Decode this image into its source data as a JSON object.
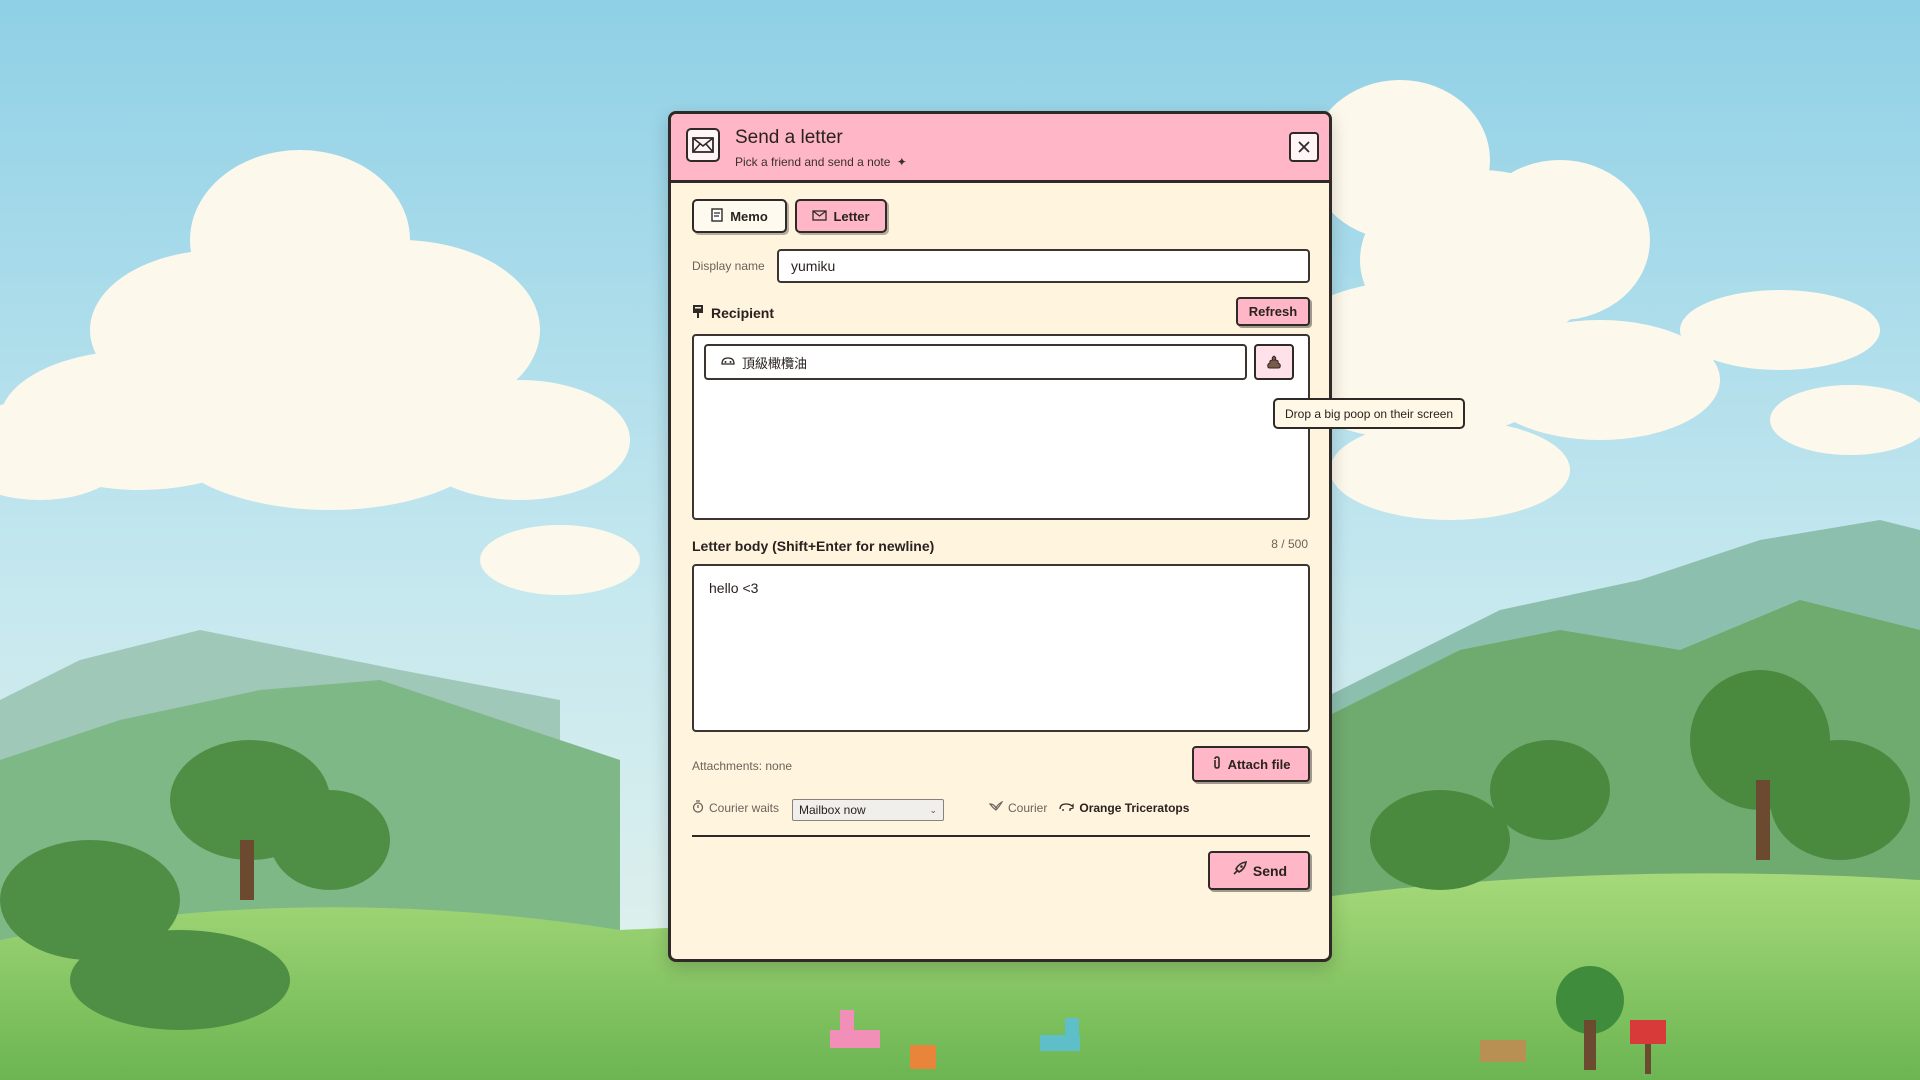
{
  "dialog": {
    "title": "Send a letter",
    "subtitle": "Pick a friend and send a note",
    "icons": {
      "app": "envelope-icon",
      "close": "close-icon",
      "subtitle_sparkle": "sparkle-icon"
    }
  },
  "tabs": [
    {
      "label": "Memo",
      "icon": "memo-icon",
      "selected": false
    },
    {
      "label": "Letter",
      "icon": "envelope-icon",
      "selected": true
    }
  ],
  "display_name": {
    "label": "Display name",
    "value": "yumiku"
  },
  "recipient": {
    "section_label": "Recipient",
    "refresh_label": "Refresh",
    "friend_name": "頂級橄欖油",
    "poop_tooltip": "Drop a big poop on their screen"
  },
  "letter": {
    "label": "Letter body (Shift+Enter for newline)",
    "counter": "8 / 500",
    "body": "hello <3"
  },
  "attachments": {
    "label": "Attachments: none",
    "button_label": "Attach file"
  },
  "courier": {
    "wait_label": "Courier waits",
    "wait_selected": "Mailbox now",
    "courier_label": "Courier",
    "courier_name": "Orange Triceratops"
  },
  "send_label": "Send",
  "colors": {
    "accent_pink": "#ffb6c7",
    "panel_cream": "#fff4dd",
    "border_dark": "#2f2a27"
  }
}
